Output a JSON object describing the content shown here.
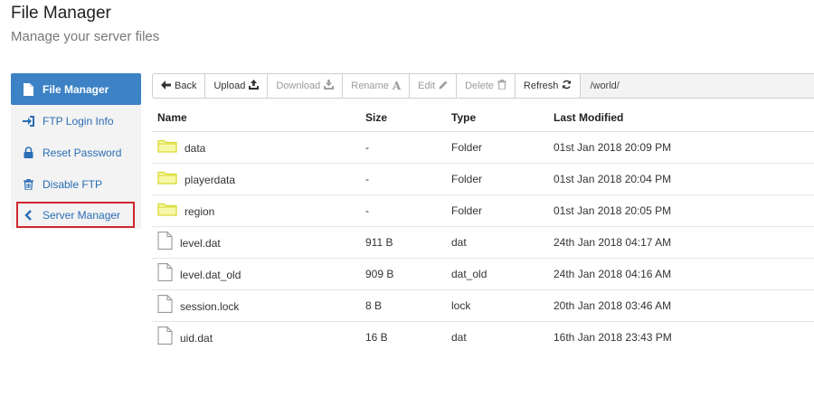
{
  "header": {
    "title": "File Manager",
    "subtitle": "Manage your server files"
  },
  "sidebar": {
    "items": [
      {
        "label": "File Manager",
        "icon": "file-icon"
      },
      {
        "label": "FTP Login Info",
        "icon": "sign-in-icon"
      },
      {
        "label": "Reset Password",
        "icon": "lock-icon"
      },
      {
        "label": "Disable FTP",
        "icon": "trash-icon"
      },
      {
        "label": "Server Manager",
        "icon": "chevron-left-icon"
      }
    ]
  },
  "toolbar": {
    "back_label": "Back",
    "upload_label": "Upload",
    "download_label": "Download",
    "rename_label": "Rename",
    "edit_label": "Edit",
    "delete_label": "Delete",
    "refresh_label": "Refresh",
    "path": "/world/"
  },
  "table": {
    "headers": [
      "Name",
      "Size",
      "Type",
      "Last Modified"
    ],
    "rows": [
      {
        "name": "data",
        "size": "-",
        "type": "Folder",
        "modified": "01st Jan 2018 20:09 PM",
        "icon": "folder-icon"
      },
      {
        "name": "playerdata",
        "size": "-",
        "type": "Folder",
        "modified": "01st Jan 2018 20:04 PM",
        "icon": "folder-icon"
      },
      {
        "name": "region",
        "size": "-",
        "type": "Folder",
        "modified": "01st Jan 2018 20:05 PM",
        "icon": "folder-icon"
      },
      {
        "name": "level.dat",
        "size": "911 B",
        "type": "dat",
        "modified": "24th Jan 2018 04:17 AM",
        "icon": "file-icon"
      },
      {
        "name": "level.dat_old",
        "size": "909 B",
        "type": "dat_old",
        "modified": "24th Jan 2018 04:16 AM",
        "icon": "file-icon"
      },
      {
        "name": "session.lock",
        "size": "8 B",
        "type": "lock",
        "modified": "20th Jan 2018 03:46 AM",
        "icon": "file-icon"
      },
      {
        "name": "uid.dat",
        "size": "16 B",
        "type": "dat",
        "modified": "16th Jan 2018 23:43 PM",
        "icon": "file-icon"
      }
    ]
  },
  "colors": {
    "accent": "#3c82c4",
    "link": "#2a6db5",
    "highlight_border": "#d0262d",
    "folder": "#e8e84a"
  }
}
